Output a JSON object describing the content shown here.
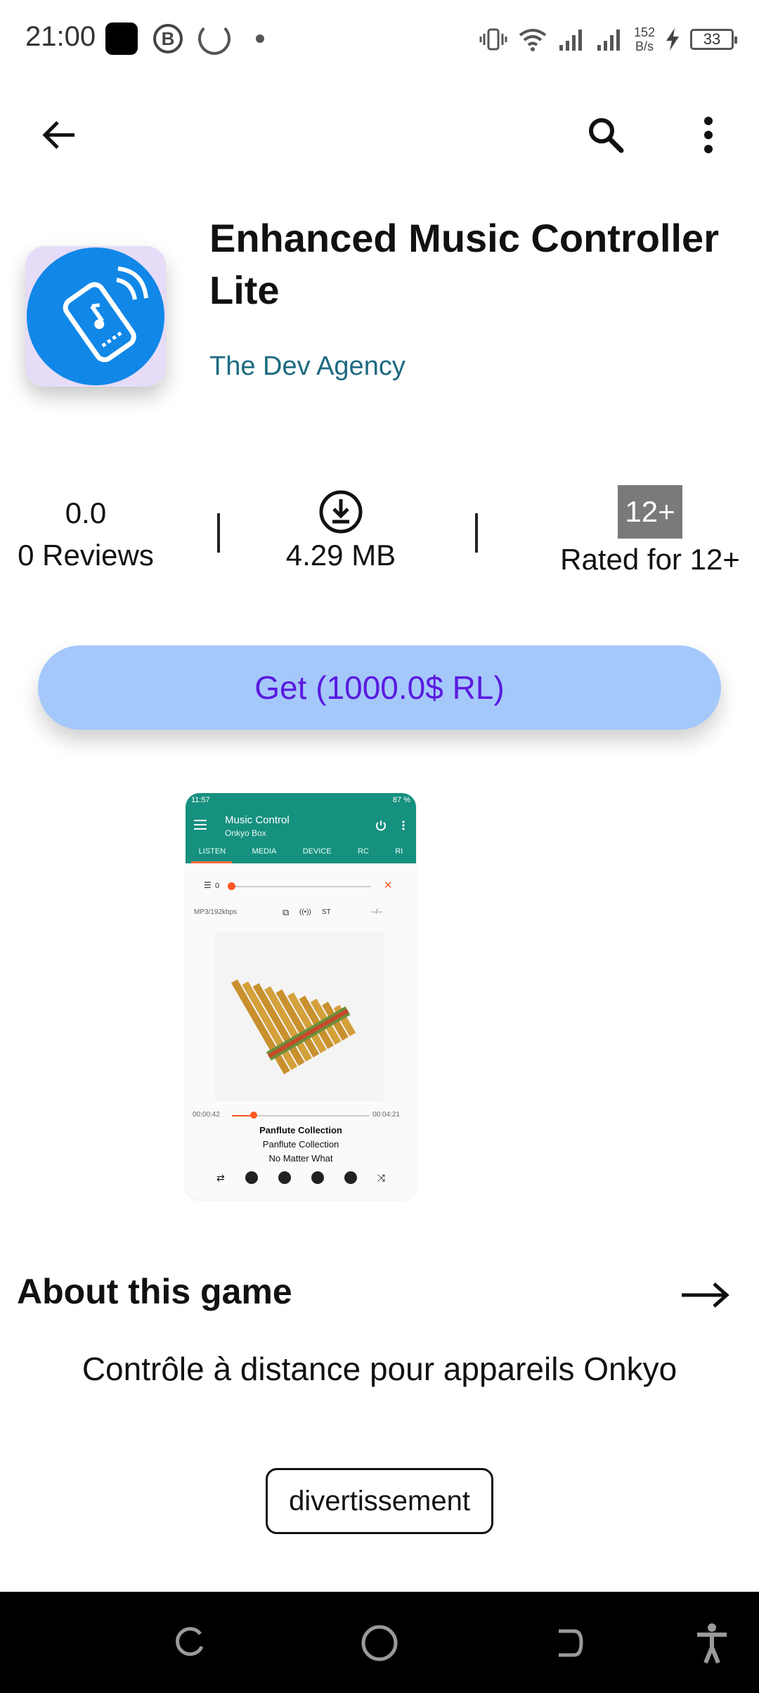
{
  "status_bar": {
    "time": "21:00",
    "b_badge": "B",
    "net_speed_value": "152",
    "net_speed_unit": "B/s",
    "battery": "33"
  },
  "icons": {
    "back": "arrow-left-icon",
    "search": "search-icon",
    "more": "more-vertical-icon",
    "download": "download-icon",
    "about_arrow": "arrow-right-icon",
    "nav_recents": "recents-icon",
    "nav_home": "home-icon",
    "nav_back": "back-icon",
    "nav_accessibility": "accessibility-icon"
  },
  "app": {
    "title": "Enhanced Music Controller Lite",
    "developer": "The Dev Agency"
  },
  "stats": {
    "rating": "0.0",
    "reviews": "0 Reviews",
    "size": "4.29 MB",
    "age_badge": "12+",
    "age_label": "Rated for 12+"
  },
  "get_button": {
    "label": "Get (1000.0$ RL)"
  },
  "screenshot": {
    "status_time": "11:57",
    "status_battery": "87 %",
    "title": "Music Control",
    "subtitle": "Onkyo Box",
    "tabs": [
      "LISTEN",
      "MEDIA",
      "DEVICE",
      "RC",
      "RI"
    ],
    "volume": "0",
    "format": "MP3/192kbps",
    "stereo": "ST",
    "track_num": "--/--",
    "time_elapsed": "00:00:42",
    "time_total": "00:04:21",
    "track_title": "Panflute Collection",
    "album": "Panflute Collection",
    "artist": "No Matter What"
  },
  "about": {
    "title": "About this game",
    "description": "Contrôle à distance pour appareils Onkyo",
    "tag": "divertissement"
  },
  "colors": {
    "accent": "#5a1ae0",
    "get_button_bg": "#a5c8fb",
    "developer": "#1d6a80",
    "app_icon_blue": "#1187e8",
    "screenshot_teal": "#16907f"
  }
}
